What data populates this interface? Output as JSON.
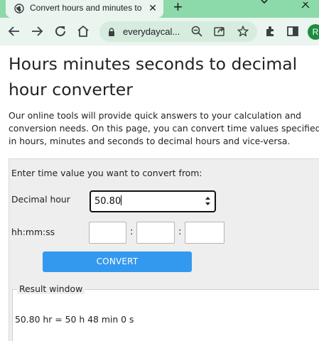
{
  "browser": {
    "tab_title": "Convert hours and minutes to",
    "tab_close": "✕",
    "new_tab": "+",
    "url": "everydaycal...",
    "profile_initial": "R"
  },
  "page": {
    "title": "Hours minutes seconds to decimal hour converter",
    "intro": "Our online tools will provide quick answers to your calculation and conversion needs. On this page, you can convert time values specified in hours, minutes and seconds to decimal hours and vice-versa."
  },
  "form": {
    "prompt": "Enter time value you want to convert from:",
    "decimal_label": "Decimal hour",
    "decimal_value": "50.80",
    "hms_label": "hh:mm:ss",
    "hh_value": "",
    "mm_value": "",
    "ss_value": "",
    "colon": ":",
    "convert_label": "CONVERT"
  },
  "result": {
    "legend": "Result window",
    "text": "50.80 hr = 50 h 48 min 0 s"
  },
  "colors": {
    "chrome_accent": "#8cd9a9",
    "toolbar_bg": "#e9f5ee",
    "button_blue": "#3399ee",
    "panel_bg": "#eeeeee"
  },
  "icons": [
    "globe-icon",
    "back-icon",
    "forward-icon",
    "reload-icon",
    "home-icon",
    "lock-icon",
    "zoom-icon",
    "share-icon",
    "star-icon",
    "extensions-icon",
    "sidepanel-icon"
  ]
}
